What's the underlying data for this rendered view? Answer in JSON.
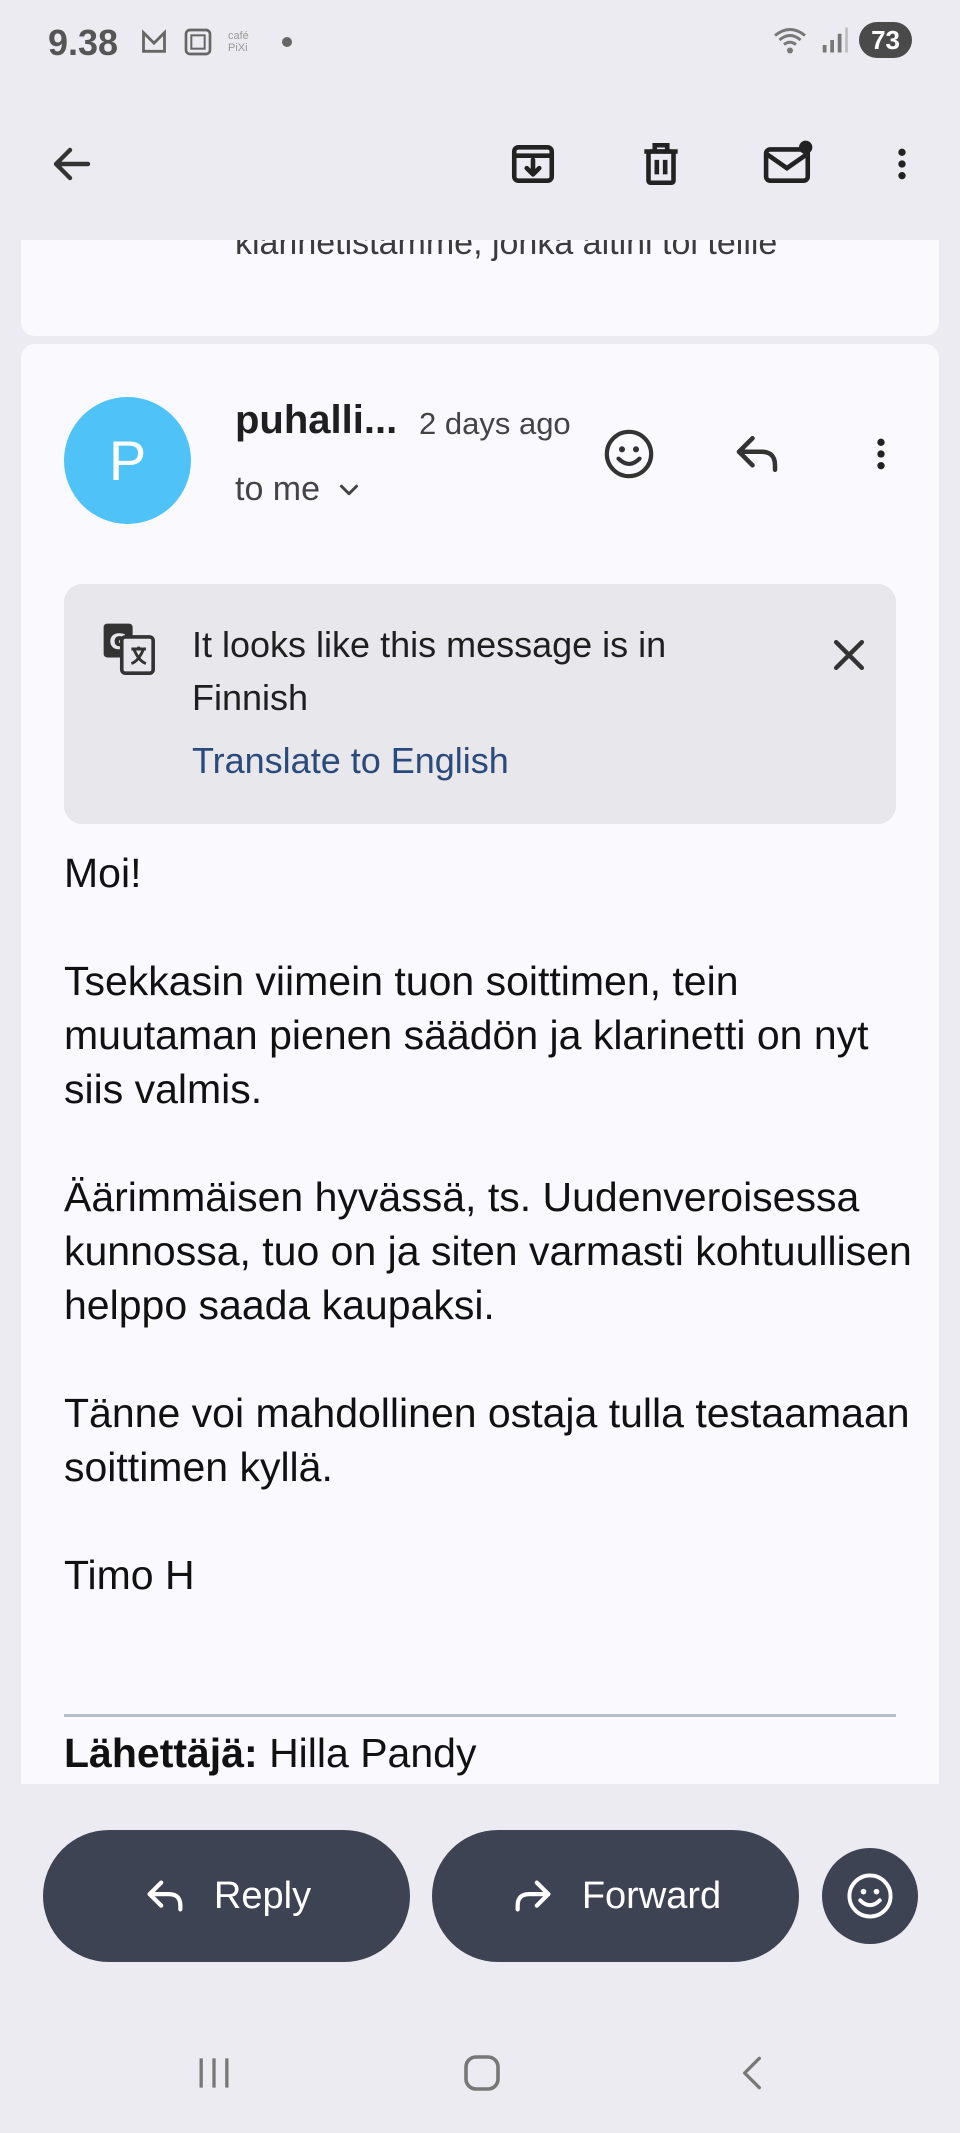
{
  "status_bar": {
    "time": "9.38",
    "battery": "73",
    "icons": [
      "mail-notification-icon",
      "screenshot-icon",
      "pixi-app-icon",
      "dot-icon",
      "wifi-icon",
      "signal-icon"
    ],
    "app_badge": "café PiXi"
  },
  "toolbar": {
    "icons": [
      "back-arrow-icon",
      "archive-icon",
      "delete-icon",
      "mark-unread-icon",
      "more-vert-icon"
    ]
  },
  "previous_message": {
    "snippet": "klarinetistamme, jonka aitini toi teille"
  },
  "message": {
    "avatar_letter": "P",
    "avatar_color": "#4fc3f7",
    "sender": "puhalli...",
    "time": "2 days ago",
    "recipient": "to me",
    "translate": {
      "message": "It looks like this message is in Finnish",
      "link": "Translate to English"
    },
    "body": [
      "Moi!",
      "Tsekkasin viimein tuon soittimen, tein muutaman pienen säädön ja klarinetti on nyt siis valmis.",
      "Äärimmäisen hyvässä, ts. Uudenveroisessa kunnossa, tuo on ja siten varmasti kohtuullisen helppo saada kaupaksi.",
      "Tänne voi mahdollinen ostaja tulla testaamaan soittimen kyllä.",
      "Timo H"
    ],
    "quoted_sender_label": "Lähettäjä:",
    "quoted_sender_name": "Hilla Pandy"
  },
  "actions": {
    "reply": "Reply",
    "forward": "Forward"
  },
  "colors": {
    "background": "#ecebf1",
    "card": "#f9f9fe",
    "action_button": "#3e4353",
    "link": "#2b4a7c"
  }
}
